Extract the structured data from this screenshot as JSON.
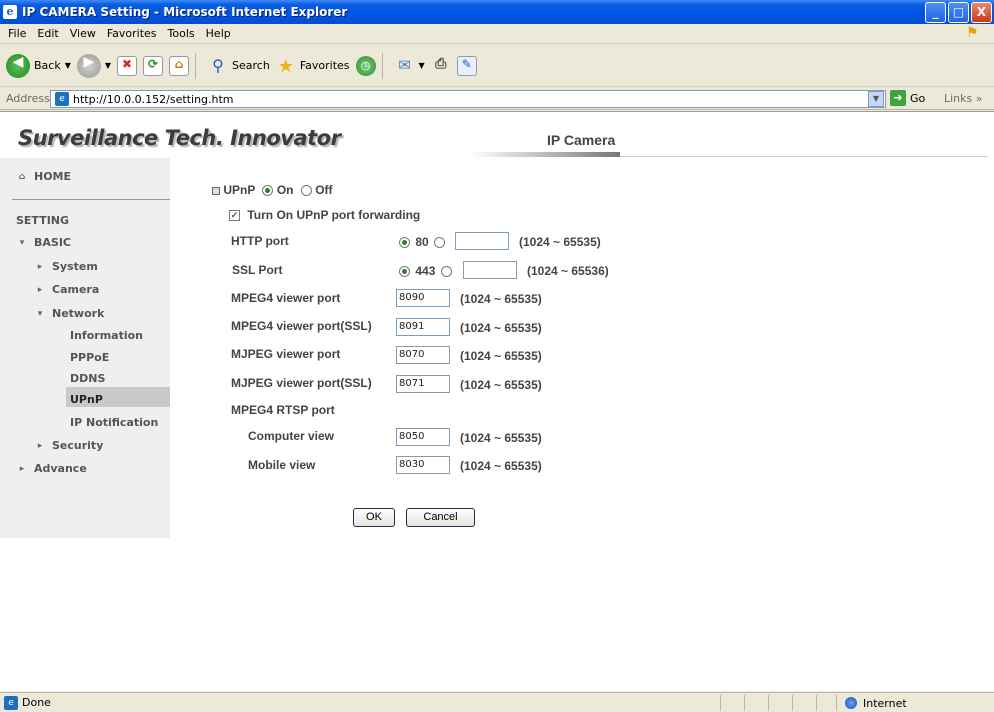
{
  "window": {
    "title": "IP CAMERA Setting - Microsoft Internet Explorer",
    "buttons": {
      "min": "_",
      "max": "□",
      "close": "X"
    }
  },
  "menu": [
    "File",
    "Edit",
    "View",
    "Favorites",
    "Tools",
    "Help"
  ],
  "toolbar": {
    "back": "Back",
    "search": "Search",
    "favorites": "Favorites"
  },
  "address": {
    "label": "Address",
    "url": "http://10.0.0.152/setting.htm",
    "go": "Go",
    "links": "Links"
  },
  "banner": {
    "brand": "Surveillance Tech. Innovator",
    "product": "IP Camera"
  },
  "sidebar": {
    "home": "HOME",
    "setting": "SETTING",
    "basic": "BASIC",
    "system": "System",
    "camera": "Camera",
    "network": "Network",
    "information": "Information",
    "pppoe": "PPPoE",
    "ddns": "DDNS",
    "upnp": "UPnP",
    "ip_notification": "IP Notification",
    "security": "Security",
    "advance": "Advance"
  },
  "form": {
    "upnp_label": "UPnP",
    "on": "On",
    "off": "Off",
    "forwarding": "Turn On UPnP port forwarding",
    "http_port": {
      "label": "HTTP port",
      "default": "80",
      "value": "",
      "range": "(1024 ~ 65535)"
    },
    "ssl_port": {
      "label": "SSL Port",
      "default": "443",
      "value": "",
      "range": "(1024 ~ 65536)"
    },
    "mpeg4_viewer": {
      "label": "MPEG4 viewer port",
      "value": "8090",
      "range": "(1024 ~ 65535)"
    },
    "mpeg4_viewer_ssl": {
      "label": "MPEG4 viewer port(SSL)",
      "value": "8091",
      "range": "(1024 ~ 65535)"
    },
    "mjpeg_viewer": {
      "label": "MJPEG viewer port",
      "value": "8070",
      "range": "(1024 ~ 65535)"
    },
    "mjpeg_viewer_ssl": {
      "label": "MJPEG viewer port(SSL)",
      "value": "8071",
      "range": "(1024 ~ 65535)"
    },
    "rtsp_label": "MPEG4 RTSP port",
    "computer_view": {
      "label": "Computer view",
      "value": "8050",
      "range": "(1024 ~ 65535)"
    },
    "mobile_view": {
      "label": "Mobile view",
      "value": "8030",
      "range": "(1024 ~ 65535)"
    },
    "ok": "OK",
    "cancel": "Cancel"
  },
  "status": {
    "text": "Done",
    "zone": "Internet"
  }
}
